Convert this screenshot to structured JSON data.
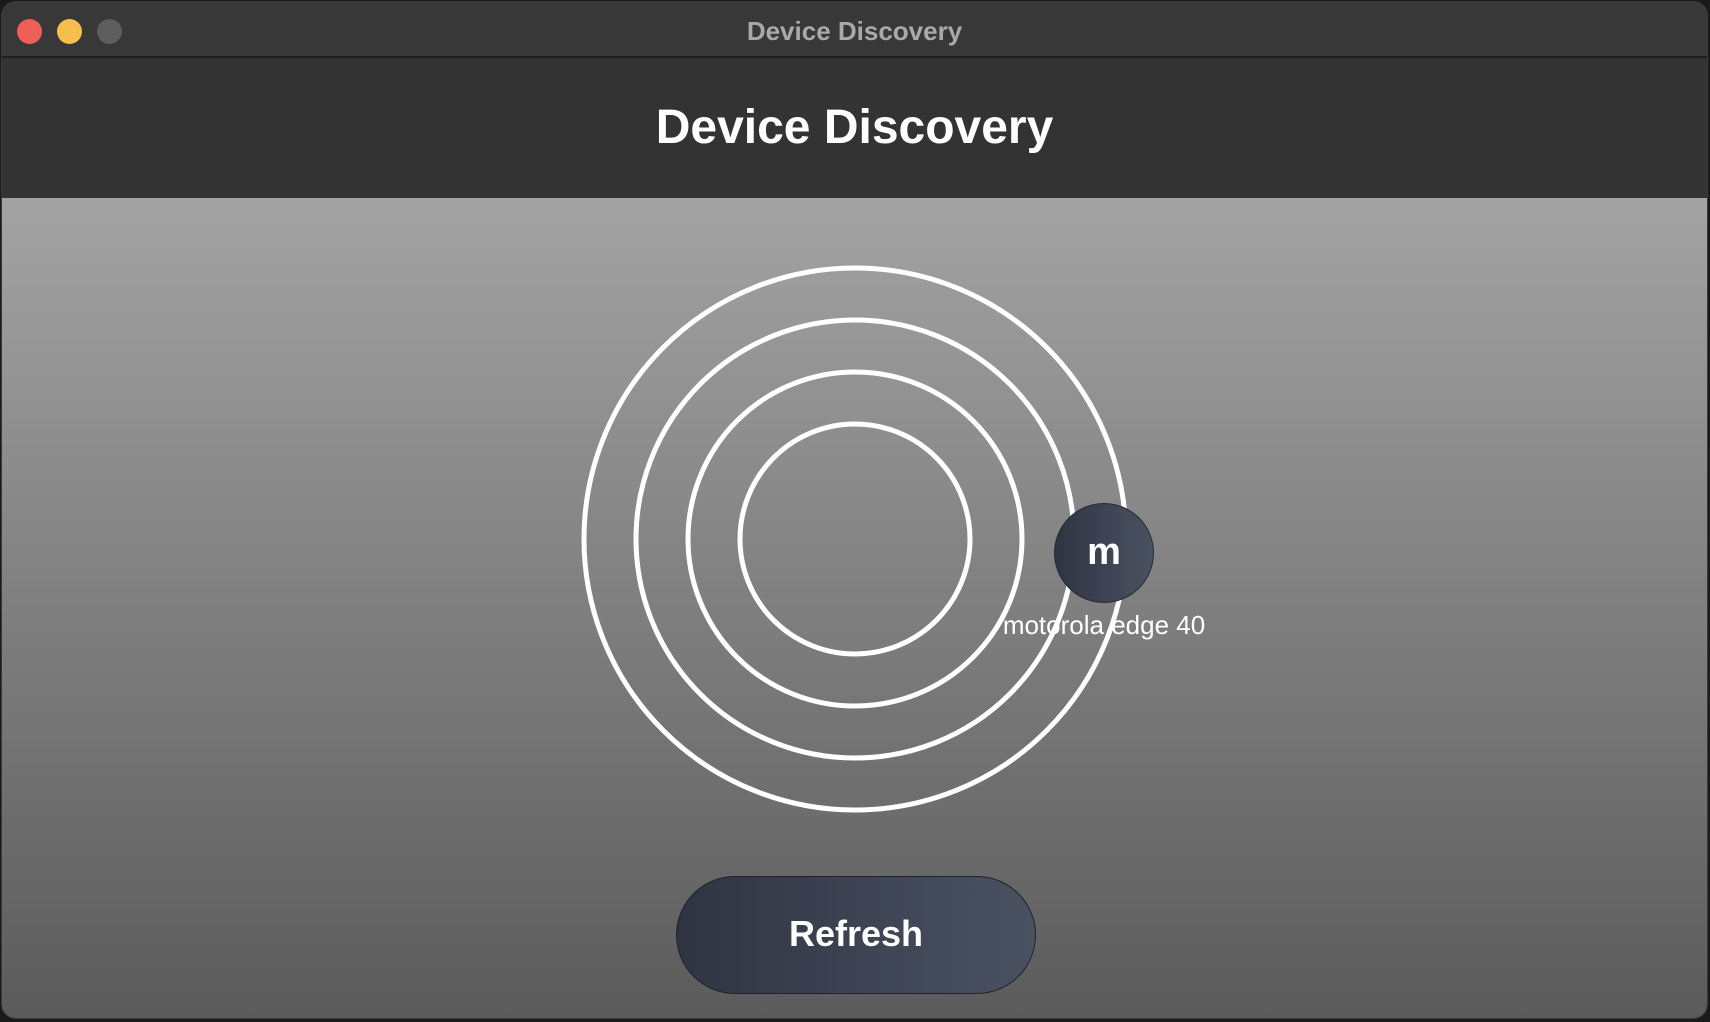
{
  "window": {
    "title": "Device Discovery"
  },
  "header": {
    "title": "Device Discovery"
  },
  "radar": {
    "ring_count": 4,
    "devices": [
      {
        "initial": "m",
        "name": "motorola edge 40"
      }
    ]
  },
  "actions": {
    "refresh_label": "Refresh"
  },
  "colors": {
    "header_bg": "#333333",
    "button_bg": "#3a404e",
    "ring": "#ffffff",
    "close": "#ee5f57",
    "minimize": "#f5bf4f",
    "zoom": "#5e5e5e"
  }
}
